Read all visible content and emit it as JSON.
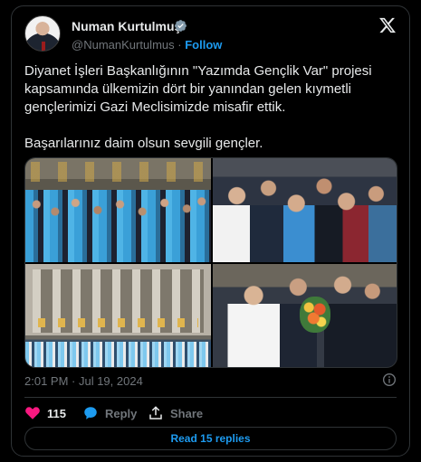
{
  "author": {
    "name": "Numan Kurtulmuş",
    "handle": "@NumanKurtulmus",
    "separator": "·",
    "follow_label": "Follow"
  },
  "tweet": {
    "text": "Diyanet İşleri Başkanlığının \"Yazımda Gençlik Var\" projesi kapsamında ülkemizin dört bir yanından gelen kıymetli gençlerimizi Gazi Meclisimizde misafir ettik.\n\nBaşarılarınız daim olsun sevgili gençler.",
    "timestamp": "2:01 PM · Jul 19, 2024"
  },
  "actions": {
    "like_count": "115",
    "reply_label": "Reply",
    "share_label": "Share"
  },
  "read_replies_label": "Read 15 replies",
  "colors": {
    "accent": "#1d9bf0",
    "like": "#f91880",
    "background": "#000000",
    "border": "#2f3336",
    "muted": "#71767b"
  },
  "icons": {
    "verified": "verified-badge-icon",
    "logo": "x-logo-icon",
    "info": "info-icon",
    "like": "heart-icon",
    "reply": "speech-bubble-icon",
    "share": "share-upload-icon"
  }
}
